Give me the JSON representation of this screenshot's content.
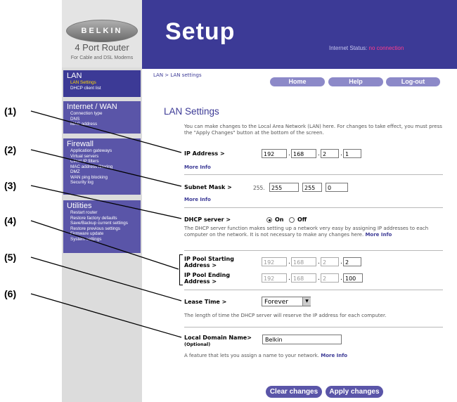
{
  "logo": {
    "brand": "BELKIN",
    "product": "4 Port Router",
    "tagline": "For Cable and DSL Modems"
  },
  "header": {
    "title": "Setup",
    "status_label": "Internet Status:",
    "status_value": "no connection"
  },
  "breadcrumb": "LAN > LAN settings",
  "top_buttons": {
    "home": "Home",
    "help": "Help",
    "logout": "Log-out"
  },
  "sidebar": {
    "lan": {
      "head": "LAN",
      "items": [
        "LAN Settings",
        "DHCP client list"
      ]
    },
    "wan": {
      "head": "Internet / WAN",
      "items": [
        "Connection type",
        "DNS",
        "MAC address"
      ]
    },
    "firewall": {
      "head": "Firewall",
      "items": [
        "Application gateways",
        "Virtual servers",
        "Client IP filters",
        "MAC address filtering",
        "DMZ",
        "WAN ping blocking",
        "Security log"
      ]
    },
    "utilities": {
      "head": "Utilities",
      "items": [
        "Restart router",
        "Restore factory defaults",
        "Save/Backup current settings",
        "Restore previous settings",
        "Firmware update",
        "System settings"
      ]
    }
  },
  "main": {
    "heading": "LAN Settings",
    "intro": "You can make changes to the Local Area Network (LAN) here. For changes to take effect, you must press the \"Apply Changes\" button at the bottom of the screen.",
    "more_info": "More Info",
    "ip_label": "IP Address >",
    "ip": [
      "192",
      "168",
      "2",
      "1"
    ],
    "subnet_label": "Subnet Mask >",
    "subnet_prefix": "255.",
    "subnet": [
      "255",
      "255",
      "0"
    ],
    "dhcp_label": "DHCP server >",
    "dhcp_on": "On",
    "dhcp_off": "Off",
    "dhcp_desc": "The DHCP server function makes setting up a network very easy by assigning IP addresses to each computer on the network. It is not necessary to make any changes here.",
    "pool_start_label_1": "IP Pool Starting",
    "pool_start_label_2": "Address >",
    "pool_start": [
      "192",
      "168",
      "2",
      "2"
    ],
    "pool_end_label_1": "IP Pool Ending",
    "pool_end_label_2": "Address >",
    "pool_end": [
      "192",
      "168",
      "2",
      "100"
    ],
    "lease_label": "Lease Time >",
    "lease_value": "Forever",
    "lease_desc": "The length of time the DHCP server will reserve the IP address for each computer.",
    "domain_label": "Local Domain Name>",
    "domain_optional": "(Optional)",
    "domain_value": "Belkin",
    "domain_desc": "A feature that lets you assign a name to your network.",
    "clear_button": "Clear changes",
    "apply_button": "Apply changes"
  },
  "callouts": [
    "(1)",
    "(2)",
    "(3)",
    "(4)",
    "(5)",
    "(6)"
  ]
}
